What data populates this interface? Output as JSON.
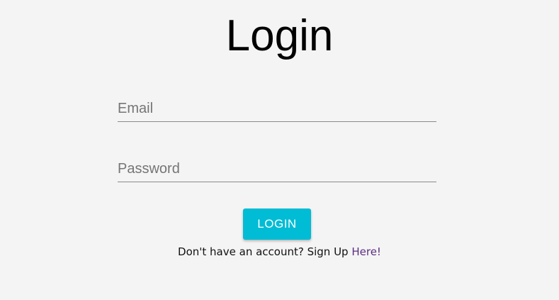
{
  "page": {
    "title": "Login"
  },
  "form": {
    "email_placeholder": "Email",
    "email_value": "",
    "password_placeholder": "Password",
    "password_value": "",
    "login_label": "LOGIN"
  },
  "signup": {
    "prompt": "Don't have an account? Sign Up ",
    "link_label": "Here!"
  },
  "colors": {
    "background": "#f4f4f4",
    "accent": "#00bcd4",
    "link": "#5b2d82",
    "underline": "#8a8a8a"
  }
}
